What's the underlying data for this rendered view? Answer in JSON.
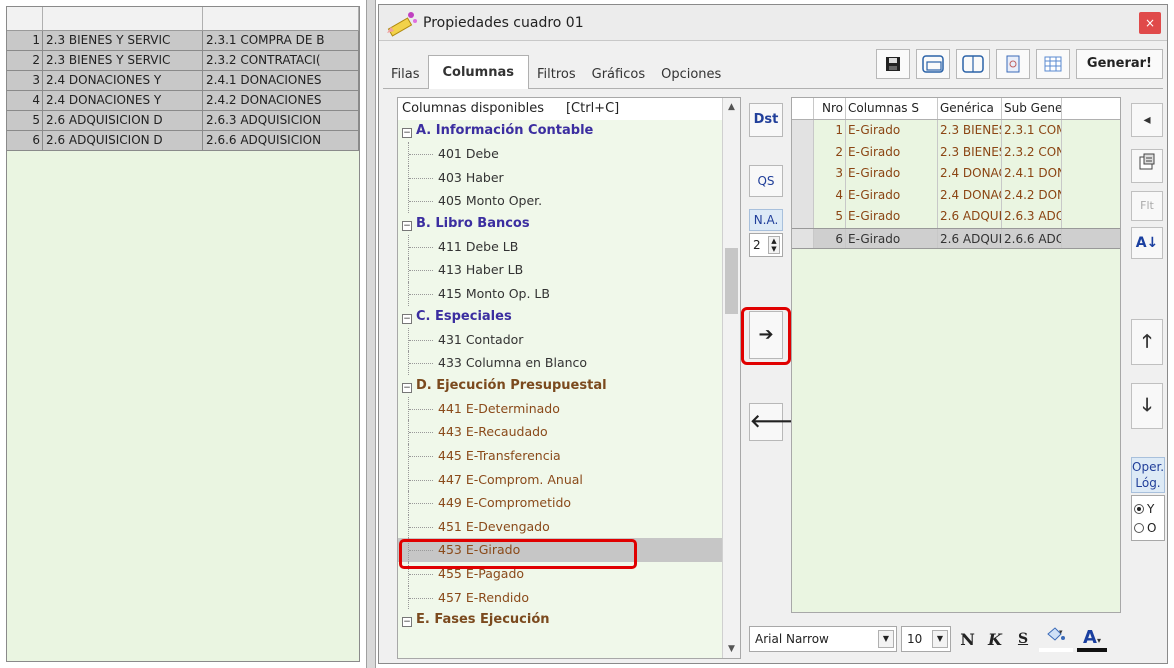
{
  "left_grid": {
    "rows": [
      {
        "n": "1",
        "c1": "2.3  BIENES Y SERVIC",
        "c2": "2.3.1  COMPRA DE B"
      },
      {
        "n": "2",
        "c1": "2.3  BIENES Y SERVIC",
        "c2": "2.3.2  CONTRATACI("
      },
      {
        "n": "3",
        "c1": "2.4  DONACIONES Y",
        "c2": "2.4.1  DONACIONES"
      },
      {
        "n": "4",
        "c1": "2.4  DONACIONES Y",
        "c2": "2.4.2  DONACIONES"
      },
      {
        "n": "5",
        "c1": "2.6  ADQUISICION D",
        "c2": "2.6.3  ADQUISICION"
      },
      {
        "n": "6",
        "c1": "2.6  ADQUISICION D",
        "c2": "2.6.6  ADQUISICION"
      }
    ]
  },
  "dialog": {
    "title": "Propiedades cuadro 01",
    "close_label": "×",
    "tabs": [
      {
        "label": "Filas",
        "active": false
      },
      {
        "label": "Columnas",
        "active": true
      },
      {
        "label": "Filtros",
        "active": false
      },
      {
        "label": "Gráficos",
        "active": false
      },
      {
        "label": "Opciones",
        "active": false
      }
    ],
    "generar_label": "Generar!"
  },
  "tree": {
    "header": "Columnas disponibles",
    "header_shortcut": "[Ctrl+C]",
    "sections": [
      {
        "label": "A. Información Contable",
        "items": [
          "401 Debe",
          "403 Haber",
          "405 Monto Oper."
        ]
      },
      {
        "label": "B. Libro Bancos",
        "items": [
          "411 Debe LB",
          "413 Haber LB",
          "415 Monto Op. LB"
        ]
      },
      {
        "label": "C. Especiales",
        "items": [
          "431 Contador",
          "433 Columna en Blanco"
        ]
      },
      {
        "label": "D. Ejecución Presupuestal",
        "items": [
          "441 E-Determinado",
          "443 E-Recaudado",
          "445 E-Transferencia",
          "447 E-Comprom. Anual",
          "449 E-Comprometido",
          "451 E-Devengado",
          "453 E-Girado",
          "455 E-Pagado",
          "457 E-Rendido"
        ]
      },
      {
        "label": "E. Fases Ejecución",
        "items": []
      }
    ],
    "selected_item": "453 E-Girado"
  },
  "middle": {
    "dst_label": "Dst",
    "qs_label": "QS",
    "na_label": "N.A.",
    "na_value": "2",
    "add_label": "➔",
    "remove_label": "🡐"
  },
  "right_grid": {
    "headers": [
      "",
      "Nro",
      "Columnas S",
      "Genérica",
      "Sub Generi"
    ],
    "rows": [
      {
        "nro": "1",
        "col": "E-Girado",
        "gen": "2.3  BIENES",
        "sub": "2.3.1  COM"
      },
      {
        "nro": "2",
        "col": "E-Girado",
        "gen": "2.3  BIENES",
        "sub": "2.3.2  CON"
      },
      {
        "nro": "3",
        "col": "E-Girado",
        "gen": "2.4  DONAC",
        "sub": "2.4.1  DON"
      },
      {
        "nro": "4",
        "col": "E-Girado",
        "gen": "2.4  DONAC",
        "sub": "2.4.2  DON"
      },
      {
        "nro": "5",
        "col": "E-Girado",
        "gen": "2.6  ADQUI",
        "sub": "2.6.3  ADQ"
      },
      {
        "nro": "6",
        "col": "E-Girado",
        "gen": "2.6  ADQUI",
        "sub": "2.6.6  ADQ"
      }
    ],
    "selected_row": 6
  },
  "right_toolbar": {
    "collapse_label": "◂",
    "filter_label": "Flt",
    "sort_label": "A↓",
    "up_label": "🡑",
    "down_label": "🡓",
    "oper_label_1": "Oper.",
    "oper_label_2": "Lóg.",
    "radio_y": "Y",
    "radio_o": "O",
    "radio_selected": "Y"
  },
  "font_bar": {
    "font": "Arial Narrow",
    "size": "10",
    "bold_label": "N",
    "italic_label": "K",
    "strike_label": "S",
    "color_label": "A"
  },
  "colors": {
    "highlight_red": "#e00000",
    "grid_green": "#eaf5e1",
    "section_blue": "#3b2ea0",
    "section_brown": "#7b4a1e"
  }
}
